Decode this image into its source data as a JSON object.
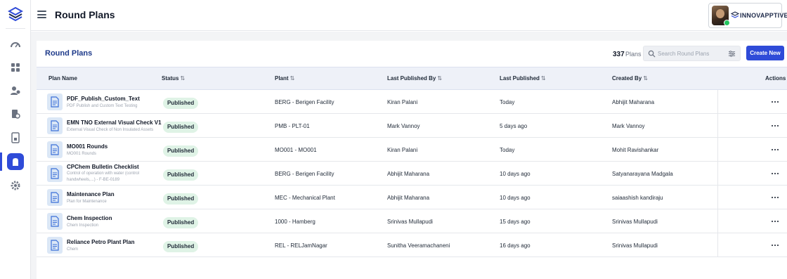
{
  "header": {
    "title": "Round Plans",
    "brand": "INNOVAPPTIVE"
  },
  "sidebar": {
    "items": [
      {
        "icon": "dashboard-gauge-icon"
      },
      {
        "icon": "grid-icon"
      },
      {
        "icon": "users-icon"
      },
      {
        "icon": "inspection-icon"
      },
      {
        "icon": "document-icon"
      },
      {
        "icon": "round-plans-icon",
        "active": true
      },
      {
        "icon": "gear-icon"
      }
    ]
  },
  "card": {
    "title": "Round Plans",
    "count": "337",
    "count_label": "Plans",
    "search_placeholder": "Search Round Plans",
    "create_label": "Create New"
  },
  "table": {
    "columns": {
      "plan_name": "Plan Name",
      "status": "Status",
      "plant": "Plant",
      "last_published_by": "Last Published By",
      "last_published": "Last Published",
      "created_by": "Created By",
      "actions": "Actions"
    },
    "sort_glyph": "⇅",
    "rows": [
      {
        "name": "PDF_Publish_Custom_Text",
        "desc": "PDF Publish and Custom Text Testing",
        "status": "Published",
        "plant": "BERG - Berigen Facility",
        "published_by": "Kiran Palani",
        "published": "Today",
        "created_by": "Abhijit Maharana"
      },
      {
        "name": "EMN TNO External Visual Check V1",
        "desc": "External Visual Check of Non Insulated Assets",
        "status": "Published",
        "plant": "PMB - PLT-01",
        "published_by": "Mark Vannoy",
        "published": "5 days ago",
        "created_by": "Mark Vannoy"
      },
      {
        "name": "MO001 Rounds",
        "desc": "MO001 Rounds",
        "status": "Published",
        "plant": "MO001 - MO001",
        "published_by": "Kiran Palani",
        "published": "Today",
        "created_by": "Mohit Ravishankar"
      },
      {
        "name": "CPChem Bulletin Checklist",
        "desc": "Control of operation with water (control",
        "desc2": "handwheels,...) - F-BE-0189",
        "status": "Published",
        "plant": "BERG - Berigen Facility",
        "published_by": "Abhijit Maharana",
        "published": "10 days ago",
        "created_by": "Satyanarayana Madgala"
      },
      {
        "name": "Maintenance Plan",
        "desc": "Plan for Maintenance",
        "status": "Published",
        "plant": "MEC - Mechanical Plant",
        "published_by": "Abhijit Maharana",
        "published": "10 days ago",
        "created_by": "saiaashish kandiraju"
      },
      {
        "name": "Chem Inspection",
        "desc": "Chem Inspection",
        "status": "Published",
        "plant": "1000 - Hamberg",
        "published_by": "Srinivas Mullapudi",
        "published": "15 days ago",
        "created_by": "Srinivas Mullapudi"
      },
      {
        "name": "Reliance Petro Plant Plan",
        "desc": "Chem",
        "status": "Published",
        "plant": "REL - RELJamNagar",
        "published_by": "Sunitha Veeramachaneni",
        "published": "16 days ago",
        "created_by": "Srinivas Mullapudi"
      }
    ]
  },
  "colors": {
    "accent": "#2f4bd8",
    "title_blue": "#1e3a8a",
    "badge_bg": "#dff3e6",
    "header_row_bg": "#eef1f8"
  }
}
